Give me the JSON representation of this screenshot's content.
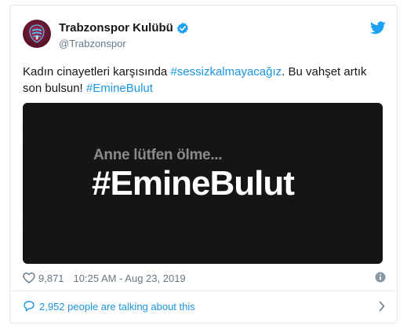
{
  "author": {
    "display_name": "Trabzonspor Kulübü",
    "handle": "@Trabzonspor",
    "verified": true,
    "avatar_icon": "trabzonspor-crest-icon"
  },
  "tweet": {
    "text_before": "Kadın cinayetleri karşısında ",
    "hashtag_1": "#sessizkalmayacağız",
    "text_middle": ". Bu vahşet artık son bulsun! ",
    "hashtag_2": "#EmineBulut"
  },
  "media": {
    "subtitle": "Anne lütfen ölme...",
    "headline": "#EmineBulut"
  },
  "meta": {
    "like_count": "9,871",
    "timestamp": "10:25 AM - Aug 23, 2019"
  },
  "footer": {
    "talking_text": "2,952 people are talking about this"
  },
  "colors": {
    "link": "#1b95e0",
    "text": "#14171a",
    "muted": "#657786",
    "media_bg": "#131313"
  }
}
